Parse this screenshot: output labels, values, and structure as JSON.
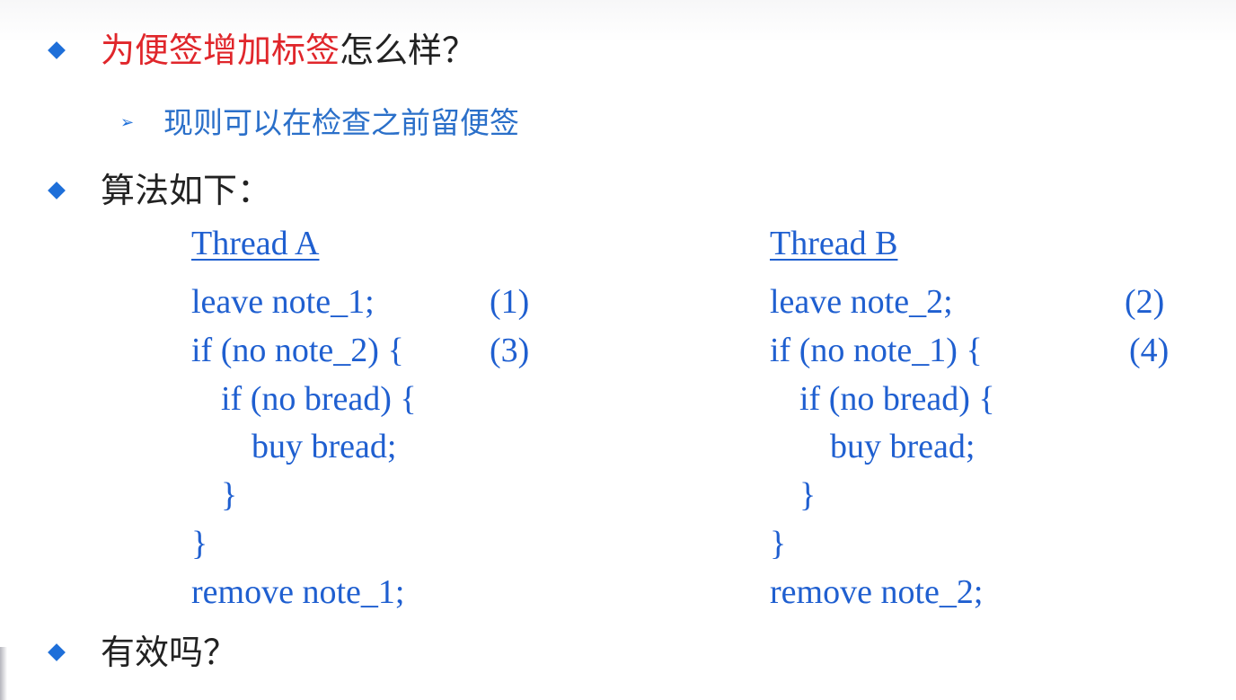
{
  "bullets": [
    {
      "red": "为便签增加标签",
      "rest": "怎么样？"
    },
    {
      "text": "算法如下："
    },
    {
      "text": "有效吗？"
    }
  ],
  "sub_bullet": "现则可以在检查之前留便签",
  "thread_a": {
    "title": "Thread A",
    "lines": [
      "leave note_1;",
      "if (no note_2) {",
      "if (no bread) {",
      "buy bread;",
      "}",
      "}",
      "remove note_1;"
    ],
    "markers": [
      "(1)",
      "(3)"
    ]
  },
  "thread_b": {
    "title": "Thread B",
    "lines": [
      "leave note_2;",
      "if (no note_1) {",
      "if (no bread) {",
      "buy bread;",
      "}",
      "}",
      "remove note_2;"
    ],
    "markers": [
      "(2)",
      "(4)"
    ]
  }
}
